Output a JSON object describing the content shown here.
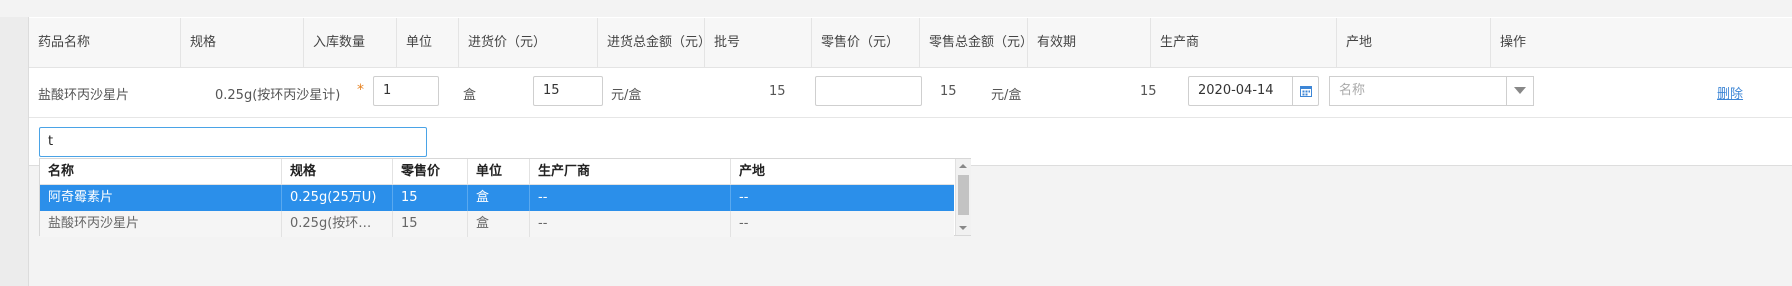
{
  "table": {
    "headers": [
      "药品名称",
      "规格",
      "入库数量",
      "单位",
      "进货价（元）",
      "进货总金额（元）",
      "批号",
      "零售价（元）",
      "零售总金额（元）",
      "有效期",
      "生产商",
      "产地",
      "操作"
    ],
    "row": {
      "name": "盐酸环丙沙星片",
      "spec": "0.25g(按环丙沙星计)",
      "required_mark": "*",
      "quantity": "1",
      "unit": "盒",
      "purchase_price": "15",
      "price_unit": "元/盒",
      "purchase_total": "15",
      "batch_no": "",
      "retail_price": "15",
      "retail_unit": "元/盒",
      "retail_total": "15",
      "expiry_date": "2020-04-14",
      "manufacturer_placeholder": "名称",
      "action_delete": "删除"
    }
  },
  "search": {
    "value": "t"
  },
  "dropdown": {
    "headers": [
      "名称",
      "规格",
      "零售价",
      "单位",
      "生产厂商",
      "产地"
    ],
    "rows": [
      [
        "阿奇霉素片",
        "0.25g(25万U)",
        "15",
        "盒",
        "--",
        "--"
      ],
      [
        "盐酸环丙沙星片",
        "0.25g(按环…",
        "15",
        "盒",
        "--",
        "--"
      ]
    ],
    "selected_index": 0
  },
  "icons": {
    "calendar": "calendar-icon",
    "chevron": "chevron-down-icon",
    "scroll_up": "scroll-up-icon",
    "scroll_down": "scroll-down-icon"
  },
  "colors": {
    "accent": "#2b8fea",
    "link": "#3d86d6",
    "required": "#e6801e",
    "focus_border": "#4aa3e6"
  }
}
